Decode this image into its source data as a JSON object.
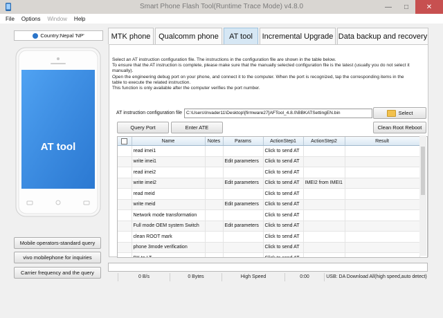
{
  "window": {
    "title": "Smart Phone Flash Tool(Runtime Trace Mode)  v4.8.0",
    "controls": [
      "—",
      "□",
      "✕"
    ]
  },
  "menu": {
    "items": [
      "File",
      "Options",
      "Window",
      "Help"
    ]
  },
  "left": {
    "country": "Country:Nepal 'NP'",
    "phone_screen_label": "AT tool",
    "buttons": [
      "Mobile operators-standard query",
      "vivo mobilephone for inquiries",
      "Carrier frequency and the query"
    ]
  },
  "tabs": [
    "MTK phone",
    "Qualcomm phone",
    "AT tool",
    "Incremental Upgrade",
    "Data backup and recovery"
  ],
  "description": [
    "Select an AT instruction configuration file. The instructions in the configuration file are shown in the table below.",
    "To ensure that the AT instruction is complete, please make sure that the manually selected configuration file is the latest (usually you do not select it",
    "manually).",
    "Open the engineering debug port on your phone, and connect it to the computer. When the port is recognized, tap the corresponding items in the",
    "table to execute the related instruction.",
    "This function is only available after the computer verifies the port number."
  ],
  "config": {
    "label": "AT instruction configuration file",
    "path": "C:\\Users\\Invader11\\Desktop\\[firmware27]AFTool_4.8.0\\BBKATSettingEN.bin",
    "select_label": "Select"
  },
  "actions": {
    "query_port": "Query Port",
    "enter_ate": "Enter ATE",
    "clean_root": "Clean Root Reboot"
  },
  "table": {
    "columns": [
      "",
      "Name",
      "Notes",
      "Params",
      "ActionStep1",
      "ActionStep2",
      "Result"
    ],
    "rows": [
      [
        "read imei1",
        "",
        "",
        "Click to send AT",
        ""
      ],
      [
        "write imei1",
        "",
        "Edit parameters",
        "Click to send AT",
        ""
      ],
      [
        "read imei2",
        "",
        "",
        "Click to send AT",
        ""
      ],
      [
        "write imei2",
        "",
        "Edit parameters",
        "Click to send AT",
        "IMEI2 from IMEI1"
      ],
      [
        "read meid",
        "",
        "",
        "Click to send AT",
        ""
      ],
      [
        "write meid",
        "",
        "Edit parameters",
        "Click to send AT",
        ""
      ],
      [
        "Network mode transformation",
        "",
        "",
        "Click to send AT",
        ""
      ],
      [
        "Full mode OEM system Switch",
        "",
        "Edit parameters",
        "Click to send AT",
        ""
      ],
      [
        "clean ROOT mark",
        "",
        "",
        "Click to send AT",
        ""
      ],
      [
        "phone 3mode verification",
        "",
        "",
        "Click to send AT",
        ""
      ],
      [
        "PX to LT",
        "",
        "",
        "Click to send AT",
        ""
      ]
    ]
  },
  "status": {
    "speed": "0 B/s",
    "bytes": "0 Bytes",
    "mode": "High Speed",
    "time": "0:00",
    "usb": "USB: DA Download All(high speed,auto detect)"
  },
  "colors": {
    "tab_active": "#d6e7f4",
    "phone_screen": "#3a8fe0"
  }
}
